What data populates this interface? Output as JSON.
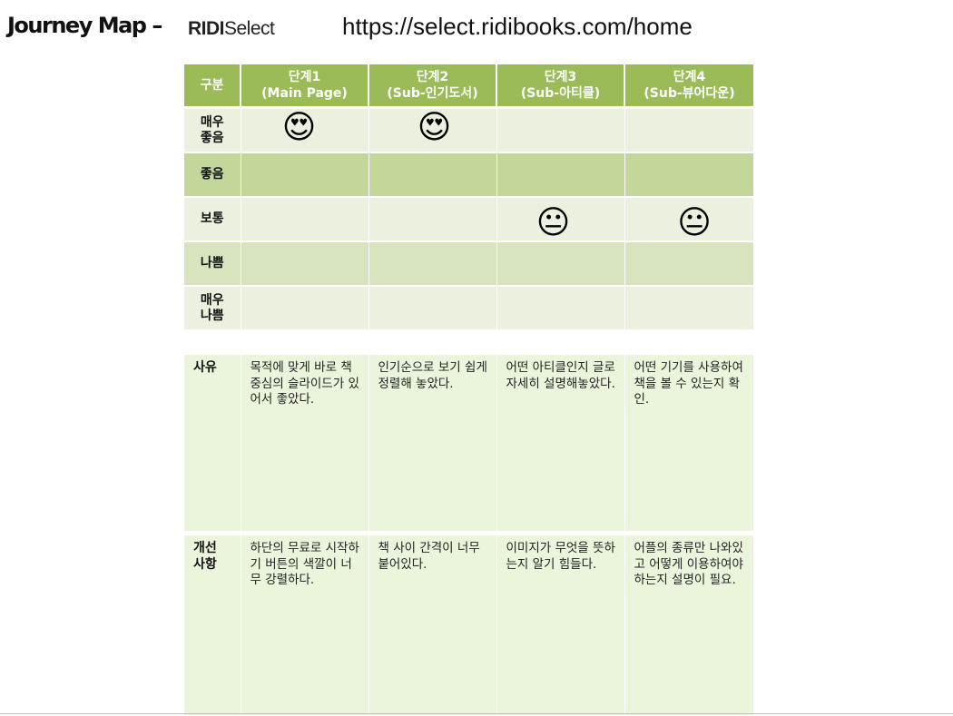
{
  "header": {
    "title": "Journey Map –",
    "brand_bold": "RIDI",
    "brand_light": "Select",
    "url": "https://select.ridibooks.com/home"
  },
  "rating_table": {
    "corner": "구분",
    "stages": [
      {
        "line1": "단계1",
        "line2": "(Main Page)"
      },
      {
        "line1": "단계2",
        "line2": "(Sub-인기도서)"
      },
      {
        "line1": "단계3",
        "line2": "(Sub-아티클)"
      },
      {
        "line1": "단계4",
        "line2": "(Sub-뷰어다운)"
      }
    ],
    "rows": [
      {
        "label1": "매우",
        "label2": "좋음"
      },
      {
        "label1": "좋음",
        "label2": ""
      },
      {
        "label1": "보통",
        "label2": ""
      },
      {
        "label1": "나쁨",
        "label2": ""
      },
      {
        "label1": "매우",
        "label2": "나쁨"
      }
    ],
    "ratings": {
      "stage1": "매우 좋음",
      "stage2": "매우 좋음",
      "stage3": "보통",
      "stage4": "보통"
    },
    "emojis": {
      "heart_eyes": "😍",
      "neutral": "😐"
    }
  },
  "detail_table": {
    "reason_label": "사유",
    "improve_label1": "개선",
    "improve_label2": "사항",
    "reasons": [
      "목적에 맞게 바로 책 중심의 슬라이드가 있어서 좋았다.",
      "인기순으로 보기 쉽게 정렬해 놓았다.",
      "어떤 아티클인지 글로 자세히 설명해놓았다.",
      "어떤 기기를 사용하여 책을 볼 수 있는지 확인."
    ],
    "improvements": [
      "하단의 무료로 시작하기 버튼의 색깔이 너무 강렬하다.",
      "책 사이 간격이 너무 붙어있다.",
      "이미지가 무엇을 뜻하는지 알기 힘들다.",
      "어플의 종류만 나와있고 어떻게 이용하여야 하는지 설명이 필요."
    ]
  },
  "colors": {
    "header_green": "#9bbb59",
    "row_light": "#ebf1de",
    "row_dark": "#d7e4bd",
    "row_mid": "#c4d79b",
    "detail_bg": "#ebf5dc"
  }
}
